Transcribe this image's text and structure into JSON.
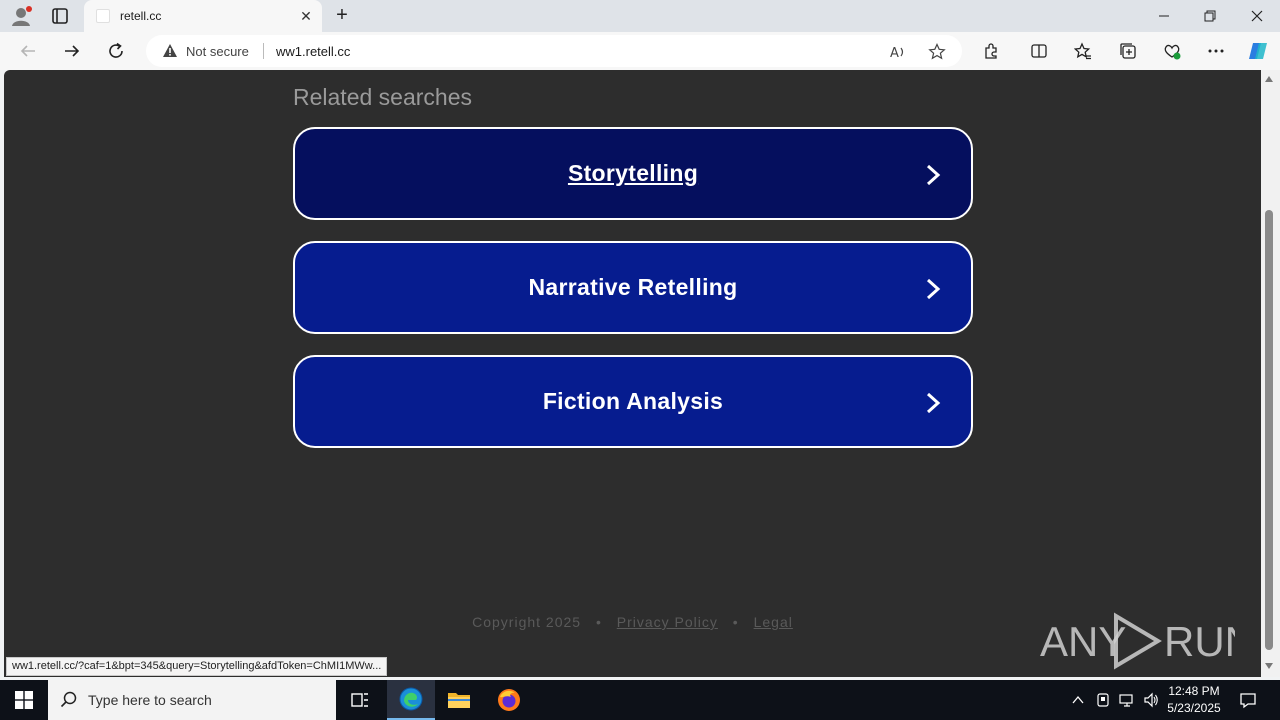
{
  "browser": {
    "tab_title": "retell.cc",
    "security_label": "Not secure",
    "url": "ww1.retell.cc",
    "status_url": "ww1.retell.cc/?caf=1&bpt=345&query=Storytelling&afdToken=ChMI1MWw..."
  },
  "page": {
    "related_heading": "Related searches",
    "results": [
      {
        "label": "Storytelling"
      },
      {
        "label": "Narrative Retelling"
      },
      {
        "label": "Fiction Analysis"
      }
    ],
    "footer": {
      "copyright": "Copyright 2025",
      "separator": "•",
      "privacy": "Privacy Policy",
      "legal": "Legal"
    },
    "watermark": "ANY RUN"
  },
  "taskbar": {
    "search_placeholder": "Type here to search",
    "time": "12:48 PM",
    "date": "5/23/2025"
  },
  "colors": {
    "page_bg": "#2d2d2d",
    "button_bg": "#061c8f",
    "button_hover_bg": "#050f5e",
    "button_border": "#ffffff"
  }
}
